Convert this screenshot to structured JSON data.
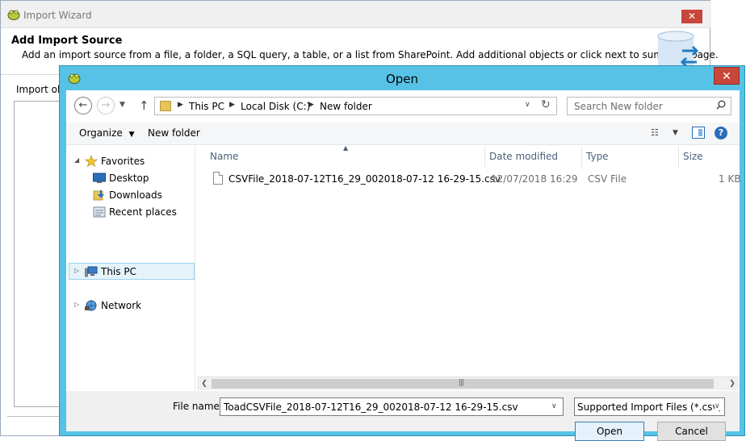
{
  "wizard": {
    "title": "Import Wizard",
    "close": "✕",
    "heading": "Add Import Source",
    "subheading": "Add an import source from a file, a folder, a SQL query, a table, or a list from SharePoint. Add additional objects or click next to summary page.",
    "import_label": "Import ob"
  },
  "dialog": {
    "title": "Open",
    "close": "✕",
    "breadcrumbs": [
      "This PC",
      "Local Disk (C:)",
      "New folder"
    ],
    "search_placeholder": "Search New folder",
    "toolbar": {
      "organize": "Organize",
      "new_folder": "New folder"
    },
    "nav": {
      "favorites": "Favorites",
      "desktop": "Desktop",
      "downloads": "Downloads",
      "recent": "Recent places",
      "this_pc": "This PC",
      "network": "Network"
    },
    "columns": [
      "Name",
      "Date modified",
      "Type",
      "Size"
    ],
    "files": [
      {
        "name": "CSVFile_2018-07-12T16_29_002018-07-12 16-29-15.csv",
        "date": "12/07/2018 16:29",
        "type": "CSV File",
        "size": "1 KB"
      }
    ],
    "file_name_label": "File name:",
    "file_name_value": "ToadCSVFile_2018-07-12T16_29_002018-07-12 16-29-15.csv",
    "filter_value": "Supported Import Files (*.csv;*.",
    "open_button": "Open",
    "cancel_button": "Cancel",
    "colors": {
      "frame": "#56c3e6",
      "close": "#c8473a",
      "selection": "#e5f3fb"
    }
  }
}
